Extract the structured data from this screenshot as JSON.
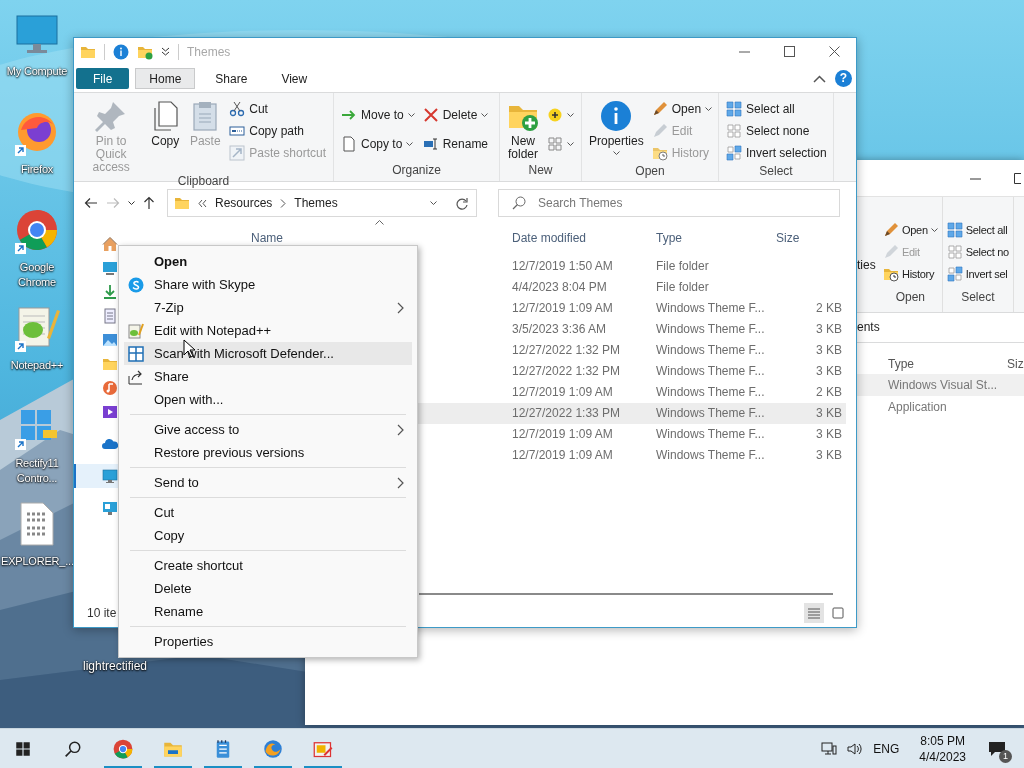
{
  "desktop": {
    "icons": [
      {
        "label": "My Compute",
        "kind": "computer",
        "shortcut": false
      },
      {
        "label": "Firefox",
        "kind": "firefox",
        "shortcut": true
      },
      {
        "label": "Google Chrome",
        "kind": "chrome",
        "shortcut": true
      },
      {
        "label": "Notepad++",
        "kind": "notepad",
        "shortcut": true
      },
      {
        "label": "Rectify11 Contro...",
        "kind": "rectify",
        "shortcut": true
      },
      {
        "label": "EXPLORER_...",
        "kind": "binary",
        "shortcut": false
      }
    ],
    "hidden_icon_label": "lightrectified"
  },
  "back_window": {
    "partial_label": "ties",
    "groups": [
      {
        "label": "Open",
        "items": [
          {
            "label": "Open",
            "disabled": false,
            "dropdown": true
          },
          {
            "label": "Edit",
            "disabled": true,
            "dropdown": false
          },
          {
            "label": "History",
            "disabled": false,
            "dropdown": false
          }
        ]
      },
      {
        "label": "Select",
        "items": [
          {
            "label": "Select all",
            "disabled": false,
            "dropdown": false
          },
          {
            "label": "Select no",
            "disabled": false,
            "dropdown": false
          },
          {
            "label": "Invert sel",
            "disabled": false,
            "dropdown": false
          }
        ]
      }
    ],
    "address_fragment": "ents",
    "columns": [
      "Type",
      "Siz"
    ],
    "rows": [
      {
        "type": "Windows Visual St...",
        "selected": true
      },
      {
        "type": "Application",
        "selected": false
      }
    ]
  },
  "window": {
    "title": "Themes",
    "help_label": "?",
    "tabs": [
      {
        "label": "File",
        "kind": "file",
        "selected": false
      },
      {
        "label": "Home",
        "kind": "tab",
        "selected": true
      },
      {
        "label": "Share",
        "kind": "tab",
        "selected": false
      },
      {
        "label": "View",
        "kind": "tab",
        "selected": false
      }
    ],
    "ribbon": {
      "groups": [
        {
          "label": "Clipboard",
          "columns": [
            [
              {
                "label": "Pin to Quick access",
                "kind": "large",
                "disabled": true,
                "dropdown": false
              }
            ],
            [
              {
                "label": "Copy",
                "kind": "large",
                "disabled": false,
                "dropdown": false
              }
            ],
            [
              {
                "label": "Paste",
                "kind": "large",
                "disabled": true,
                "dropdown": false
              }
            ],
            [
              {
                "label": "Cut",
                "kind": "small",
                "disabled": false,
                "dropdown": false
              },
              {
                "label": "Copy path",
                "kind": "small",
                "disabled": false,
                "dropdown": false
              },
              {
                "label": "Paste shortcut",
                "kind": "small",
                "disabled": true,
                "dropdown": false
              }
            ]
          ]
        },
        {
          "label": "Organize",
          "columns": [
            [
              {
                "label": "Move to",
                "kind": "small",
                "disabled": false,
                "dropdown": true
              },
              {
                "label": "Copy to",
                "kind": "small",
                "disabled": false,
                "dropdown": true
              }
            ],
            [
              {
                "label": "Delete",
                "kind": "small",
                "disabled": false,
                "dropdown": true
              },
              {
                "label": "Rename",
                "kind": "small",
                "disabled": false,
                "dropdown": false
              }
            ]
          ]
        },
        {
          "label": "New",
          "columns": [
            [
              {
                "label": "New folder",
                "kind": "large",
                "disabled": false,
                "dropdown": false
              }
            ],
            [
              {
                "kind": "small",
                "disabled": false,
                "dropdown": true
              },
              {
                "kind": "small",
                "disabled": false,
                "dropdown": true
              }
            ]
          ]
        },
        {
          "label": "Open",
          "columns": [
            [
              {
                "label": "Properties",
                "kind": "large",
                "disabled": false,
                "dropdown": true
              }
            ],
            [
              {
                "label": "Open",
                "kind": "small",
                "disabled": false,
                "dropdown": true
              },
              {
                "label": "Edit",
                "kind": "small",
                "disabled": true,
                "dropdown": false
              },
              {
                "label": "History",
                "kind": "small",
                "disabled": true,
                "dropdown": false
              }
            ]
          ]
        },
        {
          "label": "Select",
          "columns": [
            [
              {
                "label": "Select all",
                "kind": "small",
                "disabled": false,
                "dropdown": false
              },
              {
                "label": "Select none",
                "kind": "small",
                "disabled": false,
                "dropdown": false
              },
              {
                "label": "Invert selection",
                "kind": "small",
                "disabled": false,
                "dropdown": false
              }
            ]
          ]
        }
      ]
    },
    "address": {
      "path": [
        "Resources",
        "Themes"
      ]
    },
    "search": {
      "placeholder": "Search Themes"
    },
    "nav_pane": {
      "items": [
        {
          "kind": "home",
          "selected": false
        },
        {
          "kind": "desktop",
          "selected": false
        },
        {
          "kind": "downloads",
          "selected": false
        },
        {
          "kind": "documents",
          "selected": false
        },
        {
          "kind": "pictures",
          "selected": false
        },
        {
          "kind": "folder",
          "selected": false
        },
        {
          "kind": "music",
          "selected": false
        },
        {
          "kind": "videos",
          "selected": false
        },
        {
          "kind": "onedrive",
          "selected": false
        },
        {
          "kind": "pc",
          "selected": true
        },
        {
          "kind": "network",
          "selected": false
        }
      ]
    },
    "columns": [
      {
        "label": "Name",
        "sorted": true
      },
      {
        "label": "Date modified",
        "sorted": false
      },
      {
        "label": "Type",
        "sorted": false
      },
      {
        "label": "Size",
        "sorted": false
      }
    ],
    "rows": [
      {
        "date": "12/7/2019 1:50 AM",
        "type": "File folder",
        "size": "",
        "selected": false
      },
      {
        "date": "4/4/2023 8:04 PM",
        "type": "File folder",
        "size": "",
        "selected": false
      },
      {
        "date": "12/7/2019 1:09 AM",
        "type": "Windows Theme F...",
        "size": "2 KB",
        "selected": false
      },
      {
        "date": "3/5/2023 3:36 AM",
        "type": "Windows Theme F...",
        "size": "3 KB",
        "selected": false
      },
      {
        "date": "12/27/2022 1:32 PM",
        "type": "Windows Theme F...",
        "size": "3 KB",
        "selected": false
      },
      {
        "date": "12/27/2022 1:32 PM",
        "type": "Windows Theme F...",
        "size": "3 KB",
        "selected": false
      },
      {
        "date": "12/7/2019 1:09 AM",
        "type": "Windows Theme F...",
        "size": "2 KB",
        "selected": false
      },
      {
        "date": "12/27/2022 1:33 PM",
        "type": "Windows Theme F...",
        "size": "3 KB",
        "selected": true
      },
      {
        "date": "12/7/2019 1:09 AM",
        "type": "Windows Theme F...",
        "size": "3 KB",
        "selected": false
      },
      {
        "date": "12/7/2019 1:09 AM",
        "type": "Windows Theme F...",
        "size": "3 KB",
        "selected": false
      }
    ],
    "status": "10 ite",
    "view_buttons": [
      {
        "kind": "details",
        "selected": true
      },
      {
        "kind": "tiles",
        "selected": false
      }
    ]
  },
  "context_menu": {
    "items": [
      {
        "kind": "item",
        "label": "Open",
        "default": true,
        "highlighted": false,
        "submenu": false
      },
      {
        "kind": "item",
        "label": "Share with Skype",
        "default": false,
        "highlighted": false,
        "submenu": false
      },
      {
        "kind": "item",
        "label": "7-Zip",
        "default": false,
        "highlighted": false,
        "submenu": true
      },
      {
        "kind": "item",
        "label": "Edit with Notepad++",
        "default": false,
        "highlighted": false,
        "submenu": false
      },
      {
        "kind": "item",
        "label": "Scan with Microsoft Defender...",
        "default": false,
        "highlighted": true,
        "submenu": false
      },
      {
        "kind": "item",
        "label": "Share",
        "default": false,
        "highlighted": false,
        "submenu": false
      },
      {
        "kind": "item",
        "label": "Open with...",
        "default": false,
        "highlighted": false,
        "submenu": false
      },
      {
        "kind": "separator"
      },
      {
        "kind": "item",
        "label": "Give access to",
        "default": false,
        "highlighted": false,
        "submenu": true
      },
      {
        "kind": "item",
        "label": "Restore previous versions",
        "default": false,
        "highlighted": false,
        "submenu": false
      },
      {
        "kind": "separator"
      },
      {
        "kind": "item",
        "label": "Send to",
        "default": false,
        "highlighted": false,
        "submenu": true
      },
      {
        "kind": "separator"
      },
      {
        "kind": "item",
        "label": "Cut",
        "default": false,
        "highlighted": false,
        "submenu": false
      },
      {
        "kind": "item",
        "label": "Copy",
        "default": false,
        "highlighted": false,
        "submenu": false
      },
      {
        "kind": "separator"
      },
      {
        "kind": "item",
        "label": "Create shortcut",
        "default": false,
        "highlighted": false,
        "submenu": false
      },
      {
        "kind": "item",
        "label": "Delete",
        "default": false,
        "highlighted": false,
        "submenu": false
      },
      {
        "kind": "item",
        "label": "Rename",
        "default": false,
        "highlighted": false,
        "submenu": false
      },
      {
        "kind": "separator"
      },
      {
        "kind": "item",
        "label": "Properties",
        "default": false,
        "highlighted": false,
        "submenu": false
      }
    ]
  },
  "taskbar": {
    "apps": [
      {
        "kind": "start",
        "running": false
      },
      {
        "kind": "search",
        "running": false
      },
      {
        "kind": "chrome",
        "running": true
      },
      {
        "kind": "explorer",
        "running": true
      },
      {
        "kind": "notepad",
        "running": true
      },
      {
        "kind": "firefox",
        "running": true
      },
      {
        "kind": "app",
        "running": true
      }
    ],
    "tray": {
      "language": "ENG",
      "time": "8:05 PM",
      "date": "4/4/2023",
      "notifications": "1"
    }
  }
}
